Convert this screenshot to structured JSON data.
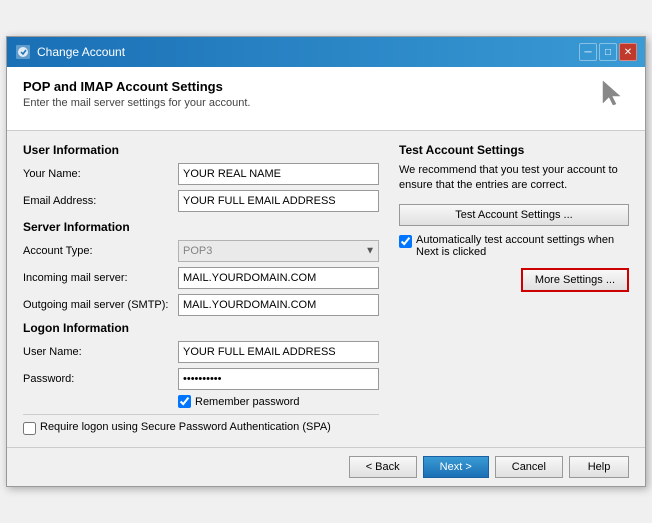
{
  "titleBar": {
    "title": "Change Account",
    "closeLabel": "✕",
    "minimizeLabel": "─",
    "maximizeLabel": "□"
  },
  "header": {
    "title": "POP and IMAP Account Settings",
    "subtitle": "Enter the mail server settings for your account."
  },
  "leftPanel": {
    "userInfoTitle": "User Information",
    "yourNameLabel": "Your Name:",
    "yourNameValue": "YOUR REAL NAME",
    "emailAddressLabel": "Email Address:",
    "emailAddressValue": "YOUR FULL EMAIL ADDRESS",
    "serverInfoTitle": "Server Information",
    "accountTypeLabel": "Account Type:",
    "accountTypeValue": "POP3",
    "incomingMailLabel": "Incoming mail server:",
    "incomingMailValue": "MAIL.YOURDOMAIN.COM",
    "outgoingMailLabel": "Outgoing mail server (SMTP):",
    "outgoingMailValue": "MAIL.YOURDOMAIN.COM",
    "logonInfoTitle": "Logon Information",
    "userNameLabel": "User Name:",
    "userNameValue": "YOUR FULL EMAIL ADDRESS",
    "passwordLabel": "Password:",
    "passwordValue": "**********",
    "rememberPasswordLabel": "Remember password",
    "spaLabel": "Require logon using Secure Password Authentication (SPA)"
  },
  "rightPanel": {
    "testAccountTitle": "Test Account Settings",
    "testAccountDesc": "We recommend that you test your account to ensure that the entries are correct.",
    "testAccountBtnLabel": "Test Account Settings ...",
    "autoTestLabel": "Automatically test account settings when Next is clicked",
    "moreSettingsLabel": "More Settings ..."
  },
  "footer": {
    "backLabel": "< Back",
    "nextLabel": "Next >",
    "cancelLabel": "Cancel",
    "helpLabel": "Help"
  }
}
